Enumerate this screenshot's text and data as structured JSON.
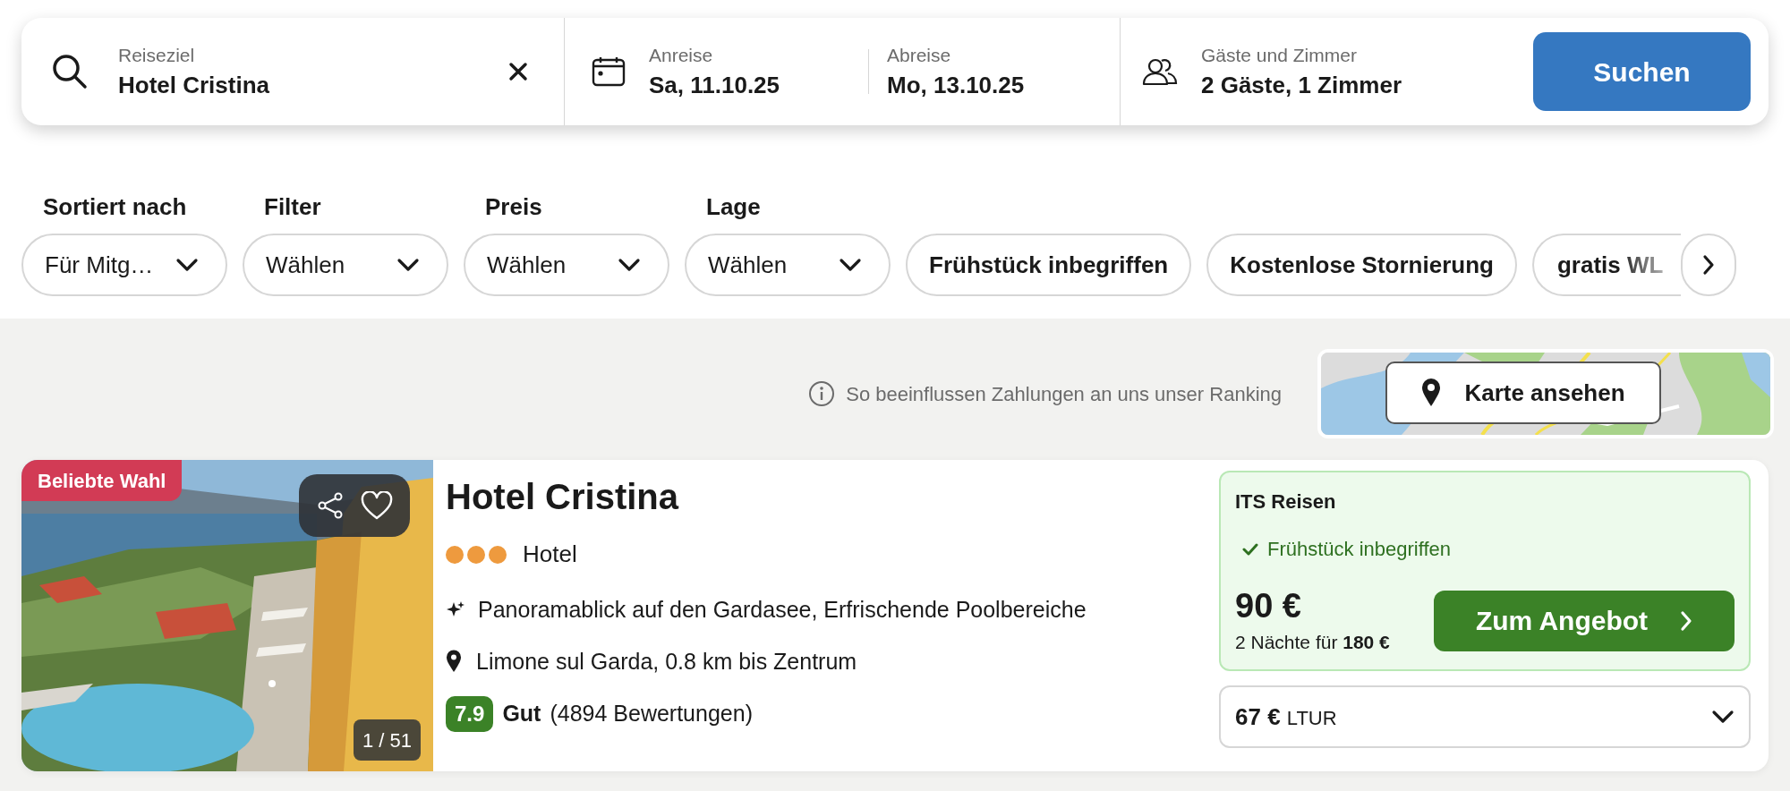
{
  "search": {
    "destination": {
      "label": "Reiseziel",
      "value": "Hotel Cristina"
    },
    "checkin": {
      "label": "Anreise",
      "value": "Sa, 11.10.25"
    },
    "checkout": {
      "label": "Abreise",
      "value": "Mo, 13.10.25"
    },
    "guests": {
      "label": "Gäste und Zimmer",
      "value": "2 Gäste, 1 Zimmer"
    },
    "button": "Suchen"
  },
  "filters": [
    {
      "label": "Sortiert nach",
      "value": "Für Mitg…"
    },
    {
      "label": "Filter",
      "value": "Wählen"
    },
    {
      "label": "Preis",
      "value": "Wählen"
    },
    {
      "label": "Lage",
      "value": "Wählen"
    }
  ],
  "chips": [
    "Frühstück inbegriffen",
    "Kostenlose Stornierung",
    "gratis WL"
  ],
  "ranking_note": "So beeinflussen Zahlungen an uns unser Ranking",
  "map_button": "Karte ansehen",
  "hotel": {
    "badge": "Beliebte Wahl",
    "photo_counter": "1 / 51",
    "name": "Hotel Cristina",
    "stars": 3,
    "type": "Hotel",
    "highlights": "Panoramablick auf den Gardasee, Erfrischende Poolbereiche",
    "location": "Limone sul Garda, 0.8 km bis Zentrum",
    "score": "7.9",
    "verdict": "Gut",
    "reviews": "(4894 Bewertungen)",
    "offer": {
      "provider": "ITS Reisen",
      "perk": "Frühstück inbegriffen",
      "price": "90 €",
      "total": "2 Nächte für **180 €**",
      "button": "Zum Angebot"
    },
    "other_offer": {
      "price": "67 €",
      "provider": "LTUR"
    }
  }
}
